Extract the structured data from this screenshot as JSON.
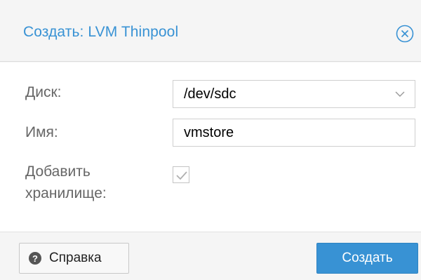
{
  "dialog": {
    "title": "Создать: LVM Thinpool",
    "close_icon": "close-circle-x"
  },
  "form": {
    "disk_label": "Диск:",
    "disk_value": "/dev/sdc",
    "name_label": "Имя:",
    "name_value": "vmstore",
    "add_storage_label_line1": "Добавить",
    "add_storage_label_line2": "хранилище:",
    "add_storage_checked": true
  },
  "footer": {
    "help_label": "Справка",
    "help_icon": "?",
    "create_label": "Создать"
  },
  "colors": {
    "accent": "#3892d4",
    "label_gray": "#666666"
  }
}
